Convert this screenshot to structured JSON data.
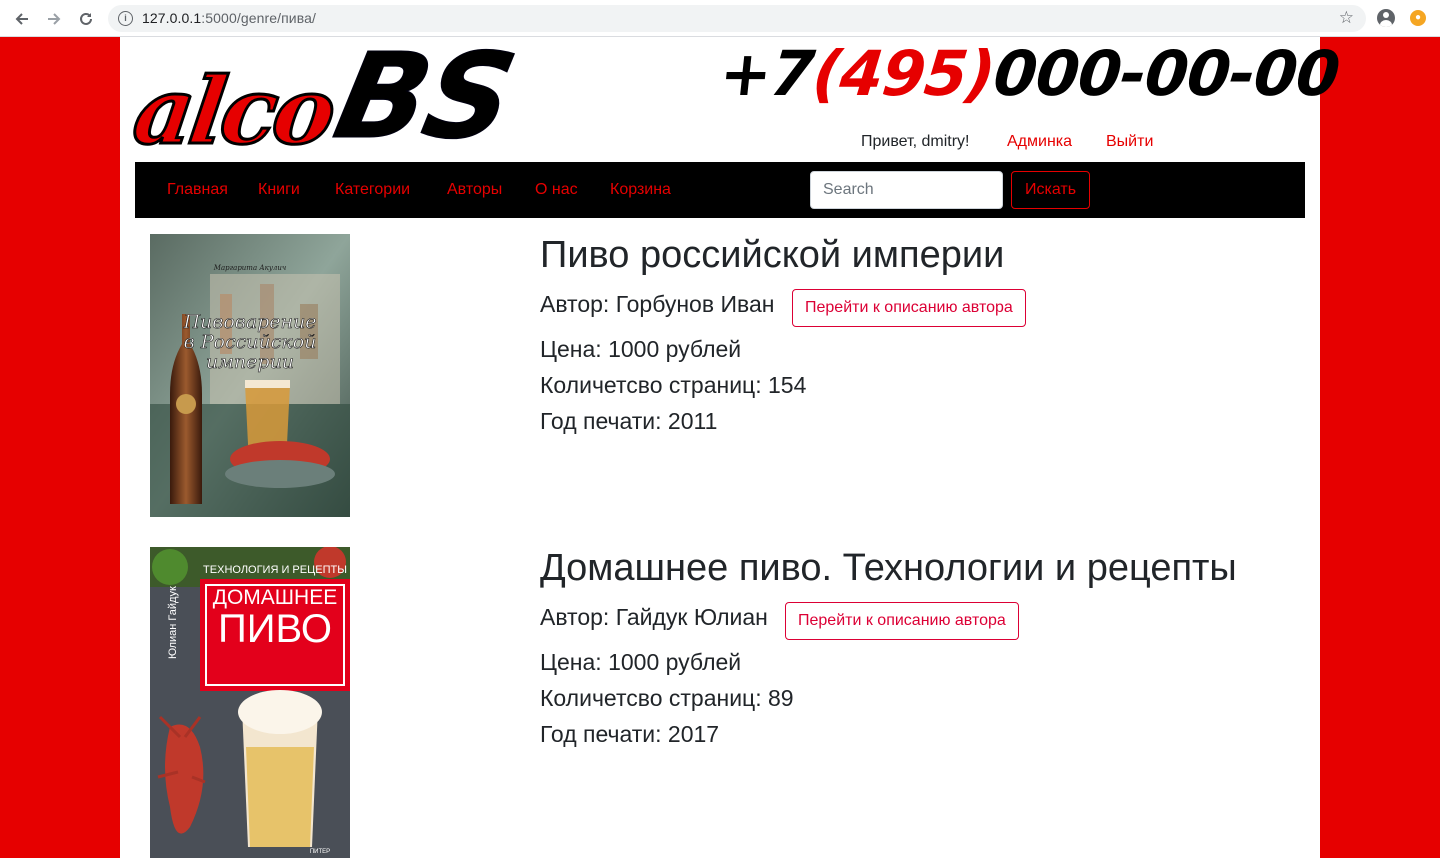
{
  "browser": {
    "url_host": "127.0.0.1",
    "url_rest": ":5000/genre/пива/"
  },
  "header": {
    "logo_part1": "alco",
    "logo_part2": "BS",
    "phone_prefix": "+7",
    "phone_code": "(495)",
    "phone_number": "000-00-00",
    "greeting": "Привет, dmitry!",
    "admin_label": "Админка",
    "logout_label": "Выйти"
  },
  "nav": {
    "items": [
      "Главная",
      "Книги",
      "Категории",
      "Авторы",
      "О нас",
      "Корзина"
    ],
    "search_placeholder": "Search",
    "search_button": "Искать"
  },
  "books": [
    {
      "title": "Пиво российской империи",
      "author": "Автор: Горбунов Иван",
      "author_button": "Перейти к описанию автора",
      "price": "Цена: 1000 рублей",
      "pages": "Количетсво страниц: 154",
      "year": "Год печати: 2011",
      "cover_author": "Маргарита Акулич",
      "cover_title": [
        "Пивоварение",
        "в Российской",
        "империи"
      ]
    },
    {
      "title": "Домашнее пиво. Технологии и рецепты",
      "author": "Автор: Гайдук Юлиан",
      "author_button": "Перейти к описанию автора",
      "price": "Цена: 1000 рублей",
      "pages": "Количетсво страниц: 89",
      "year": "Год печати: 2017",
      "cover_top": "ТЕХНОЛОГИЯ И РЕЦЕПТЫ",
      "cover_title": [
        "ДОМАШНЕЕ",
        "ПИВО"
      ],
      "cover_side": "Юлиан Гайдук",
      "cover_publisher": "ПИТЕР"
    }
  ]
}
